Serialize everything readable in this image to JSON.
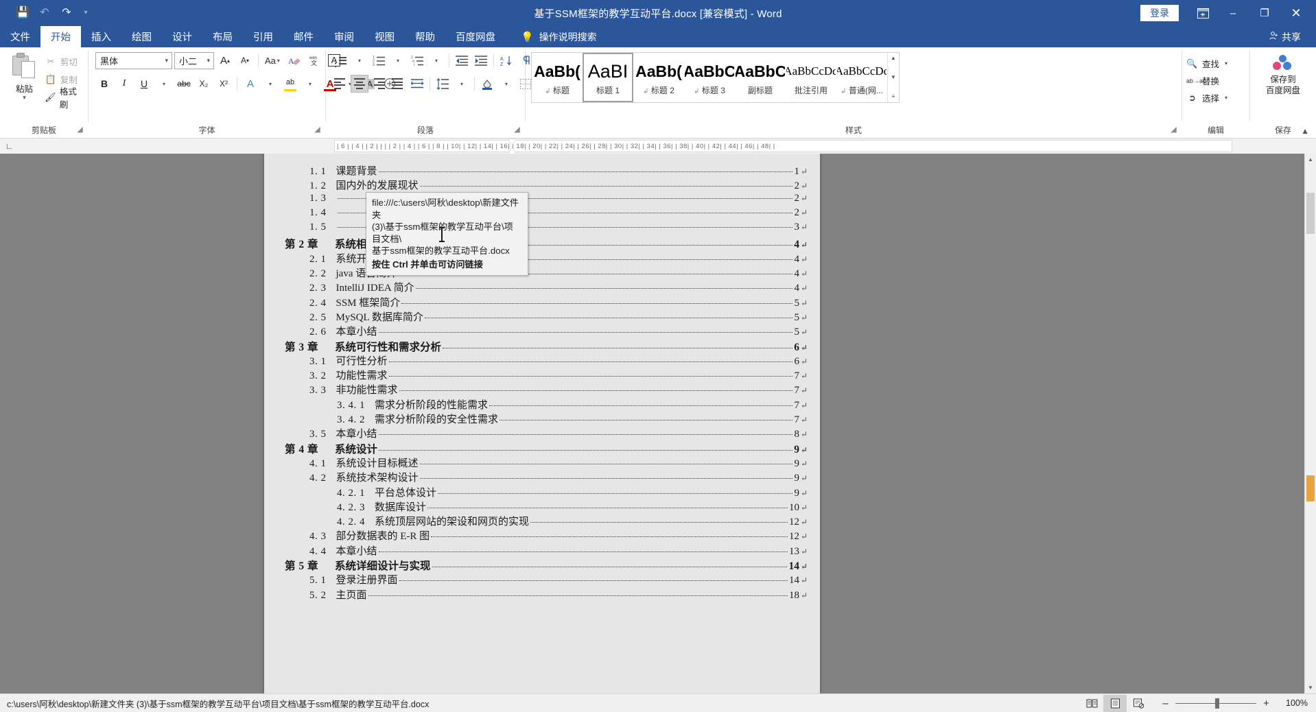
{
  "titlebar": {
    "doc_title": "基于SSM框架的教学互动平台.docx [兼容模式]  -  Word",
    "save_icon": "save-icon",
    "undo_icon": "undo-icon",
    "redo_icon": "redo-icon",
    "qat_more_icon": "customize-quick-access-icon",
    "signin_label": "登录",
    "ribbon_display_icon": "ribbon-display-options-icon",
    "minimize_label": "–",
    "restore_label": "❐",
    "close_label": "✕"
  },
  "tabs": [
    {
      "label": "文件",
      "active": false
    },
    {
      "label": "开始",
      "active": true
    },
    {
      "label": "插入",
      "active": false
    },
    {
      "label": "绘图",
      "active": false
    },
    {
      "label": "设计",
      "active": false
    },
    {
      "label": "布局",
      "active": false
    },
    {
      "label": "引用",
      "active": false
    },
    {
      "label": "邮件",
      "active": false
    },
    {
      "label": "审阅",
      "active": false
    },
    {
      "label": "视图",
      "active": false
    },
    {
      "label": "帮助",
      "active": false
    },
    {
      "label": "百度网盘",
      "active": false
    }
  ],
  "tellme": {
    "label": "操作说明搜索",
    "icon": "lightbulb-icon"
  },
  "share": {
    "label": "共享",
    "icon": "share-person-icon"
  },
  "ribbon": {
    "clipboard": {
      "group_label": "剪贴板",
      "paste_label": "粘贴",
      "cut_label": "剪切",
      "copy_label": "复制",
      "format_painter_label": "格式刷"
    },
    "font": {
      "group_label": "字体",
      "font_name": "黑体",
      "font_size": "小二",
      "grow_font": "A",
      "shrink_font": "A",
      "change_case": "Aa",
      "clear_format_icon": "clear-formatting-icon",
      "phonetic_icon": "phonetic-guide-icon",
      "char_border_icon": "character-border-icon",
      "bold": "B",
      "italic": "I",
      "underline": "U",
      "strike": "abc",
      "subscript": "X₂",
      "superscript": "X²",
      "text_effects": "A",
      "highlight": "ab",
      "font_color": "A",
      "char_shading_icon": "character-shading-icon",
      "circled_icon": "enclose-characters-icon"
    },
    "paragraph": {
      "group_label": "段落",
      "bullets_icon": "bullets-icon",
      "numbering_icon": "numbering-icon",
      "multilevel_icon": "multilevel-list-icon",
      "decrease_indent_icon": "decrease-indent-icon",
      "increase_indent_icon": "increase-indent-icon",
      "sort_icon": "sort-icon",
      "show_marks_icon": "show-paragraph-marks-icon",
      "align_left_icon": "align-left-icon",
      "align_center_icon": "align-center-icon",
      "align_right_icon": "align-right-icon",
      "justify_icon": "justify-icon",
      "distribute_icon": "distribute-text-icon",
      "line_spacing_icon": "line-spacing-icon",
      "shading_icon": "shading-icon",
      "borders_icon": "borders-icon"
    },
    "styles": {
      "group_label": "样式",
      "items": [
        {
          "preview": "AaBb(",
          "name": "标题",
          "pilcrow": true,
          "style": "bold",
          "selected": false
        },
        {
          "preview": "AaBI",
          "name": "标题 1",
          "pilcrow": false,
          "style": "h1",
          "selected": true
        },
        {
          "preview": "AaBb(",
          "name": "标题 2",
          "pilcrow": true,
          "style": "bold",
          "selected": false
        },
        {
          "preview": "AaBbC",
          "name": "标题 3",
          "pilcrow": true,
          "style": "bold",
          "selected": false
        },
        {
          "preview": "AaBbC",
          "name": "副标题",
          "pilcrow": false,
          "style": "bold",
          "selected": false
        },
        {
          "preview": "AaBbCcDd",
          "name": "批注引用",
          "pilcrow": false,
          "style": "small serif",
          "selected": false
        },
        {
          "preview": "AaBbCcDc",
          "name": "普通(网...",
          "pilcrow": true,
          "style": "small serif",
          "selected": false
        }
      ],
      "scroll_up": "▲",
      "scroll_down": "▼",
      "more": "≡"
    },
    "editing": {
      "group_label": "编辑",
      "find_label": "查找",
      "replace_label": "替换",
      "select_label": "选择",
      "find_icon": "search-icon",
      "replace_icon": "replace-icon",
      "select_icon": "pointer-select-icon"
    },
    "save": {
      "group_label": "保存",
      "baidu_line1": "保存到",
      "baidu_line2": "百度网盘",
      "baidu_icon": "baidu-netdisk-icon"
    },
    "collapse_icon": "collapse-ribbon-icon"
  },
  "ruler": {
    "corner_icon": "tab-stop-left-icon",
    "marks": "| 6 |    | 4 |    | 2 |    |        |      | 2 |    | 4 |    | 6 |    | 8 |    | 10|    | 12|    | 14|    | 16|    | 18|    | 20|    | 22|    | 24|    | 26|    | 28|    | 30|    | 32|    | 34|    | 36|    | 38|    | 40|    | 42|    | 44|    | 46|    | 48|    |"
  },
  "document": {
    "tooltip": {
      "line1": "file:///c:\\users\\阿秋\\desktop\\新建文件夹",
      "line2": "(3)\\基于ssm框架的教学互动平台\\项目文档\\",
      "line3": "基于ssm框架的教学互动平台.docx",
      "hint": "按住 Ctrl 并单击可访问链接"
    },
    "pilcrow": "↵",
    "toc": [
      {
        "level": 2,
        "num": "1. 1",
        "title": "课题背景",
        "page": "1"
      },
      {
        "level": 2,
        "num": "1. 2",
        "title": "国内外的发展现状",
        "page": "2"
      },
      {
        "level": 2,
        "num": "1. 3",
        "title": "",
        "page": "2"
      },
      {
        "level": 2,
        "num": "1. 4",
        "title": "",
        "page": "2"
      },
      {
        "level": 2,
        "num": "1. 5",
        "title": "",
        "page": "3"
      },
      {
        "level": 1,
        "num": "第 2 章",
        "title": "系统相关技术",
        "page": "4"
      },
      {
        "level": 2,
        "num": "2. 1",
        "title": "系统开发及运行环境",
        "page": "4"
      },
      {
        "level": 2,
        "num": "2. 2",
        "title": "java 语言简介",
        "page": "4"
      },
      {
        "level": 2,
        "num": "2. 3",
        "title": "IntelliJ IDEA 简介",
        "page": "4"
      },
      {
        "level": 2,
        "num": "2. 4",
        "title": "SSM 框架简介",
        "page": "5"
      },
      {
        "level": 2,
        "num": "2. 5",
        "title": "MySQL 数据库简介",
        "page": "5"
      },
      {
        "level": 2,
        "num": "2. 6",
        "title": "本章小结",
        "page": "5"
      },
      {
        "level": 1,
        "num": "第 3 章",
        "title": "系统可行性和需求分析",
        "page": "6"
      },
      {
        "level": 2,
        "num": "3. 1",
        "title": "可行性分析",
        "page": "6"
      },
      {
        "level": 2,
        "num": "3. 2",
        "title": "功能性需求",
        "page": "7"
      },
      {
        "level": 2,
        "num": "3. 3",
        "title": "非功能性需求",
        "page": "7"
      },
      {
        "level": 3,
        "num": "3. 4. 1",
        "title": "需求分析阶段的性能需求",
        "page": "7"
      },
      {
        "level": 3,
        "num": "3. 4. 2",
        "title": "需求分析阶段的安全性需求",
        "page": "7"
      },
      {
        "level": 2,
        "num": "3. 5",
        "title": "本章小结",
        "page": "8"
      },
      {
        "level": 1,
        "num": "第 4 章",
        "title": "系统设计",
        "page": "9"
      },
      {
        "level": 2,
        "num": "4. 1",
        "title": "系统设计目标概述",
        "page": "9"
      },
      {
        "level": 2,
        "num": "4. 2",
        "title": "系统技术架构设计",
        "page": "9"
      },
      {
        "level": 3,
        "num": "4. 2. 1",
        "title": "平台总体设计",
        "page": "9"
      },
      {
        "level": 3,
        "num": "4. 2. 3",
        "title": "数据库设计",
        "page": "10"
      },
      {
        "level": 3,
        "num": "4. 2. 4",
        "title": "系统顶层网站的架设和网页的实现",
        "page": "12"
      },
      {
        "level": 2,
        "num": "4. 3",
        "title": "部分数据表的 E-R 图",
        "page": "12"
      },
      {
        "level": 2,
        "num": "4. 4",
        "title": "本章小结",
        "page": "13"
      },
      {
        "level": 1,
        "num": "第 5 章",
        "title": "系统详细设计与实现",
        "page": "14"
      },
      {
        "level": 2,
        "num": "5. 1",
        "title": "登录注册界面",
        "page": "14"
      },
      {
        "level": 2,
        "num": "5. 2",
        "title": "主页面",
        "page": "18"
      }
    ]
  },
  "statusbar": {
    "path": "c:\\users\\阿秋\\desktop\\新建文件夹 (3)\\基于ssm框架的教学互动平台\\项目文档\\基于ssm框架的教学互动平台.docx",
    "view_read_icon": "read-mode-icon",
    "view_print_icon": "print-layout-icon",
    "view_web_icon": "web-layout-icon",
    "zoom_out": "–",
    "zoom_in": "+",
    "zoom_value": "100%"
  },
  "colors": {
    "word_blue": "#2b579a",
    "page_gray": "#e6e6e6",
    "workspace_gray": "#818181",
    "accent_orange": "#e8a33d"
  }
}
